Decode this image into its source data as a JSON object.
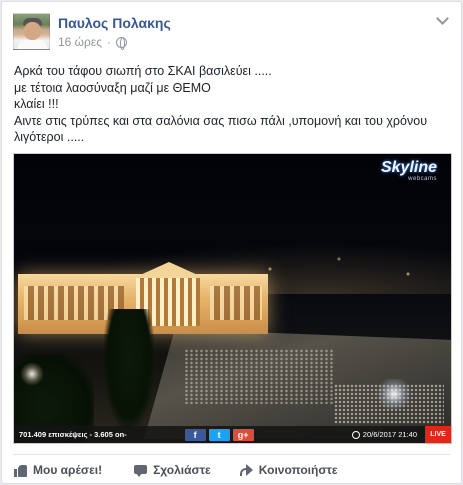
{
  "post": {
    "author": "Παυλος Πολακης",
    "timestamp": "16 ώρες",
    "audience_icon": "globe-icon",
    "menu_icon": "chevron-down-icon",
    "text_lines": [
      "Αρκά του τάφου σιωπή στο ΣΚΑΙ βασιλεύει .....",
      "με τέτοια λαοσύναξη μαζί με ΘΕΜΟ",
      "κλαίει !!!",
      "Αιντε στις τρύπες και στα σαλόνια σας πισω πάλι ,υπομονή και του χρόνου",
      "λιγότεροι ....."
    ]
  },
  "media": {
    "logo_brand": "Skyline",
    "logo_sub": "webcams",
    "views_text": "701.409 επισκέψεις - 3.605 on-",
    "share_buttons": [
      "f",
      "t",
      "g+"
    ],
    "date_text": "20/6/2017 21:40",
    "live_label": "LIVE"
  },
  "actions": {
    "like_label": "Μου αρέσει!",
    "comment_label": "Σχολιάστε",
    "share_label": "Κοινοποιήστε"
  },
  "colors": {
    "author_link": "#365899",
    "facebook": "#3b5998",
    "twitter": "#1da1f2",
    "google_plus": "#dd4b39",
    "live": "#e0271c"
  }
}
